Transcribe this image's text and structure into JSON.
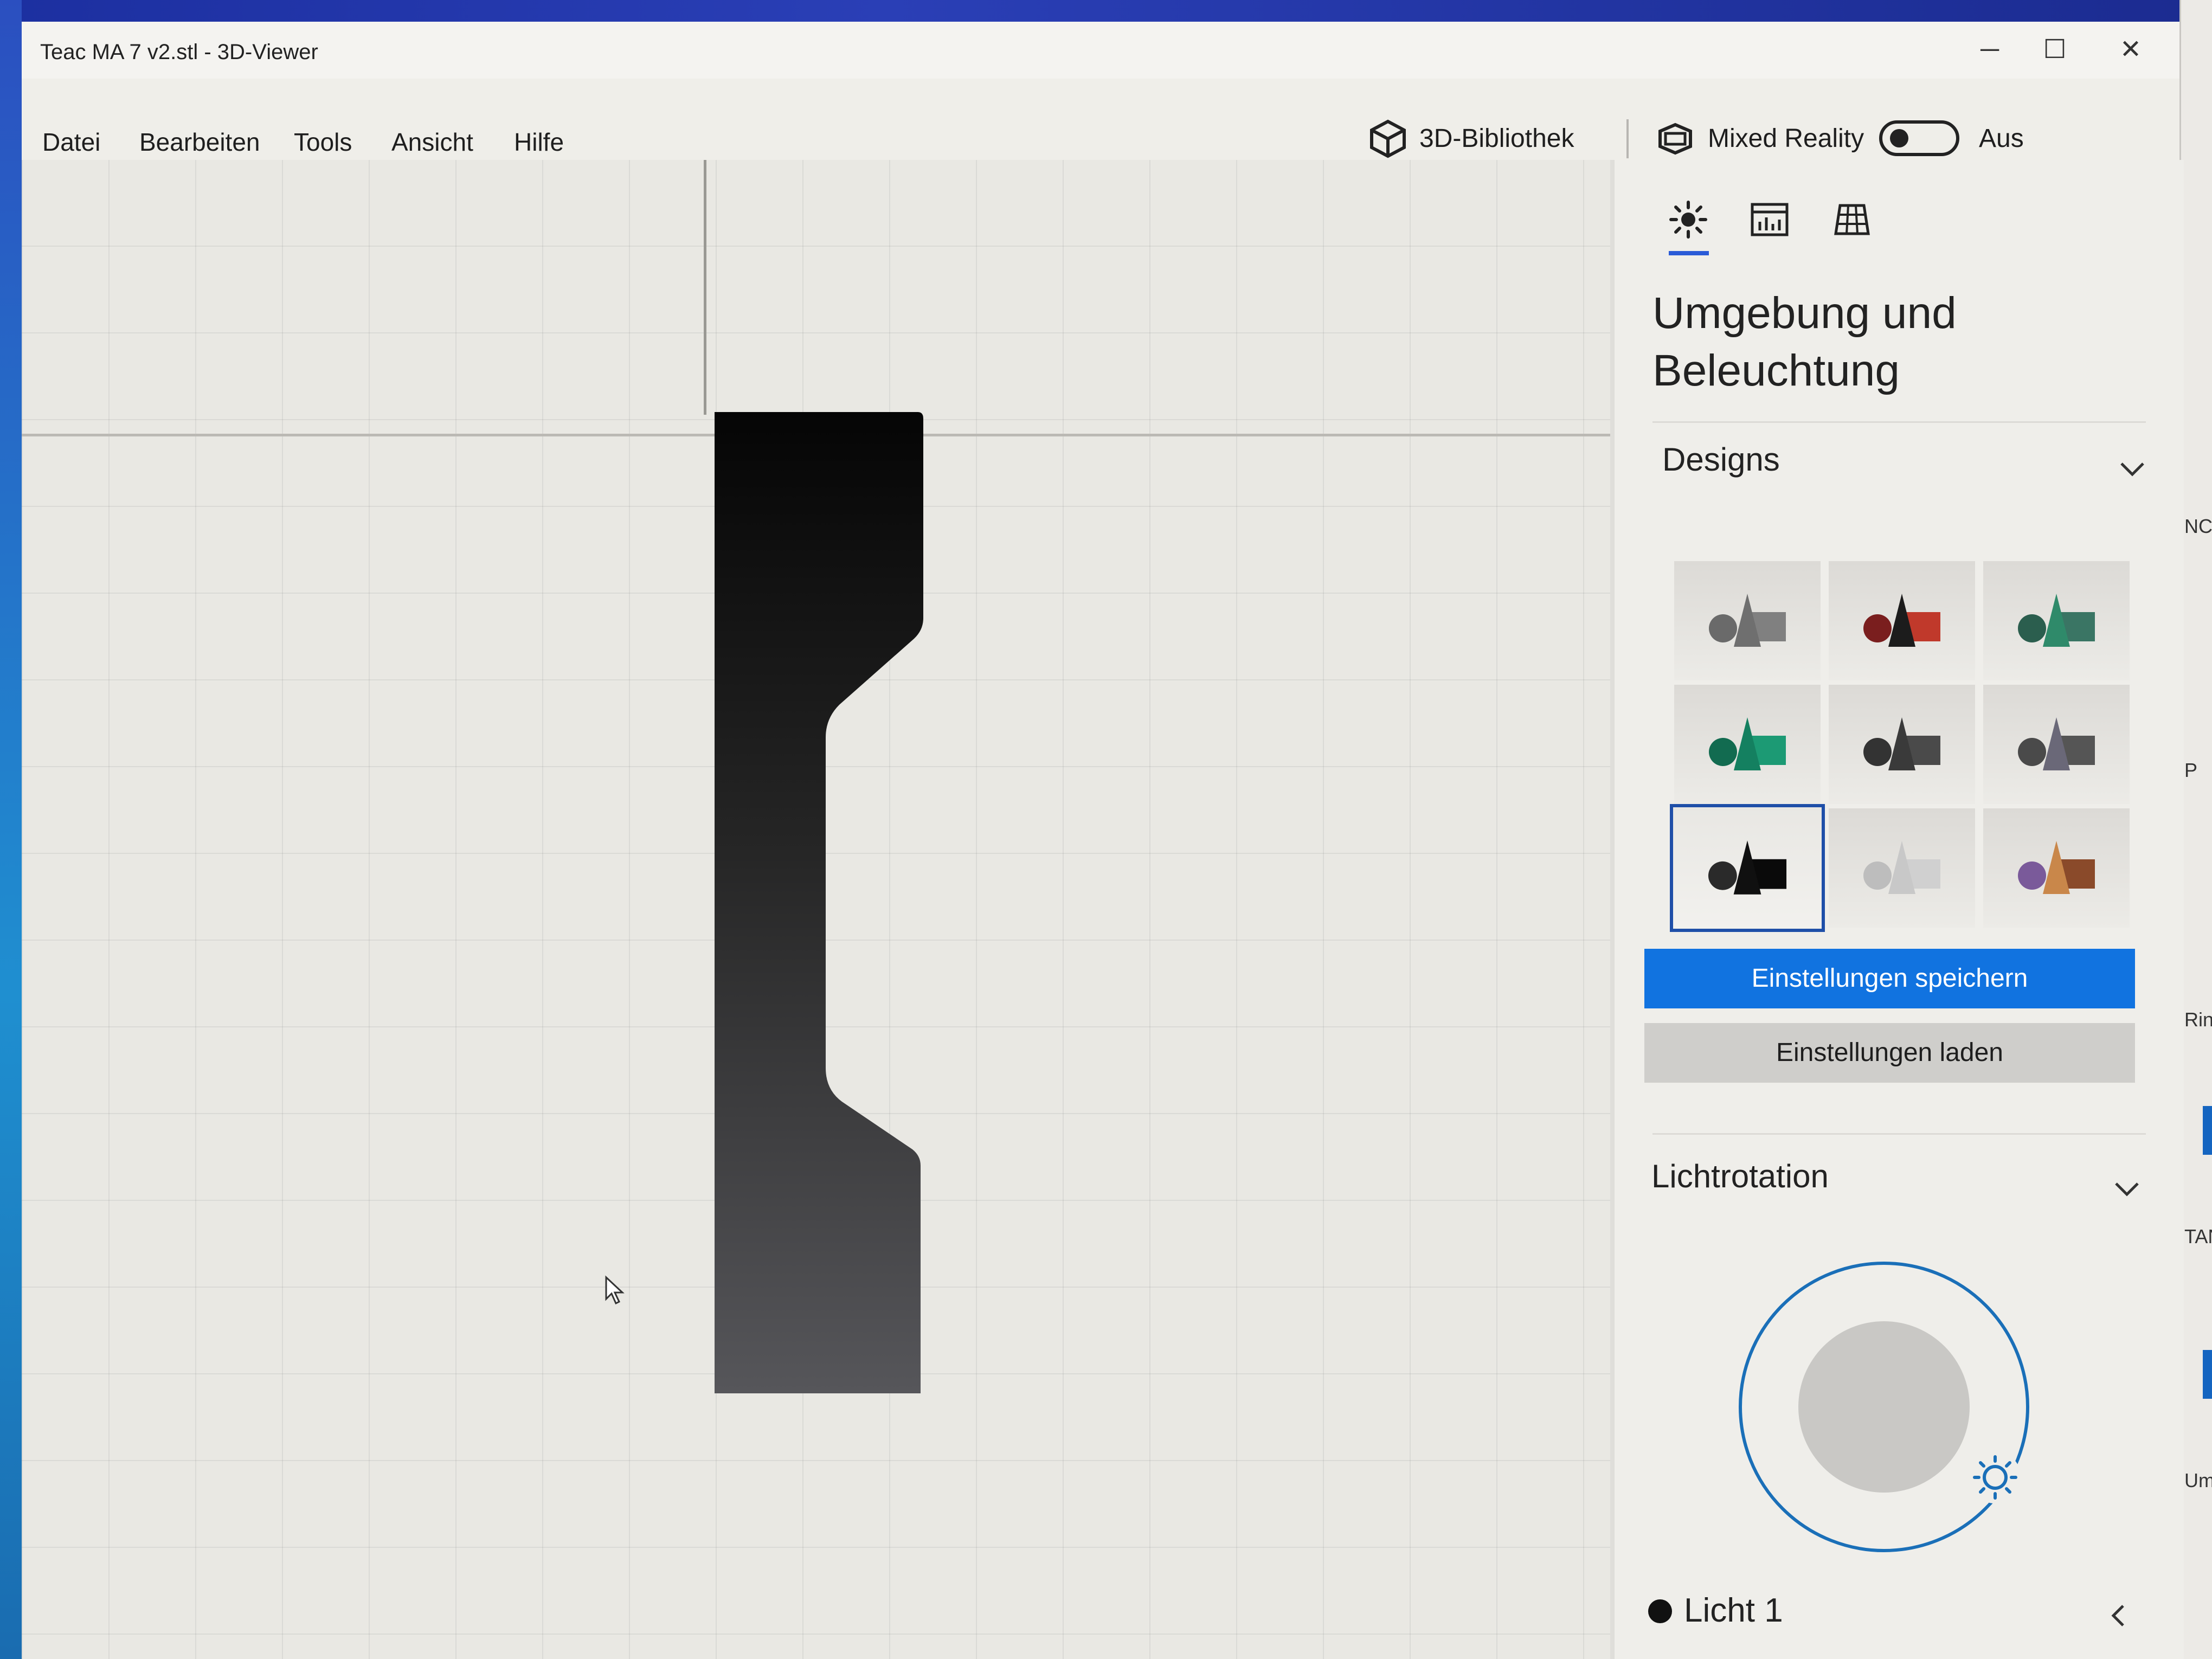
{
  "window": {
    "title": "Teac MA 7 v2.stl - 3D-Viewer",
    "controls": {
      "minimize": "─",
      "maximize": "☐",
      "close": "✕"
    }
  },
  "menu": {
    "items": [
      "Datei",
      "Bearbeiten",
      "Tools",
      "Ansicht",
      "Hilfe"
    ],
    "library_label": "3D-Bibliothek",
    "mixed_reality_label": "Mixed Reality",
    "mixed_reality_state": "Aus"
  },
  "panel": {
    "tabs": [
      "environment-lighting-tab",
      "stats-tab",
      "grid-tab"
    ],
    "heading": "Umgebung und Beleuchtung",
    "designs_label": "Designs",
    "designs": [
      {
        "cone": "#6f6f6f",
        "cube": "#808080",
        "sphere": "#6a6a6a",
        "selected": false
      },
      {
        "cone": "#1c1c1c",
        "cube": "#c0392b",
        "sphere": "#7a1e1e",
        "selected": false
      },
      {
        "cone": "#2f8a6a",
        "cube": "#3a7564",
        "sphere": "#2b5e4e",
        "selected": false
      },
      {
        "cone": "#148060",
        "cube": "#1c9a74",
        "sphere": "#126b50",
        "selected": false
      },
      {
        "cone": "#3a3a3a",
        "cube": "#4a4a4a",
        "sphere": "#333333",
        "selected": false
      },
      {
        "cone": "#6a6878",
        "cube": "#555555",
        "sphere": "#4a4a4a",
        "selected": false
      },
      {
        "cone": "#101010",
        "cube": "#0a0a0a",
        "sphere": "#2a2a2a",
        "selected": true
      },
      {
        "cone": "#c8c8c8",
        "cube": "#d0d0d0",
        "sphere": "#bdbdbd",
        "selected": false
      },
      {
        "cone": "#c9874a",
        "cube": "#8a4a2a",
        "sphere": "#7a5a9a",
        "selected": false
      }
    ],
    "save_button": "Einstellungen speichern",
    "load_button": "Einstellungen laden",
    "light_rotation_label": "Lichtrotation",
    "light_label": "Licht 1"
  },
  "desktop_fragments": [
    "NC",
    "P",
    "Rin",
    "TANI",
    "Um"
  ],
  "colors": {
    "accent": "#1173e0",
    "selected_border": "#1f4fa8",
    "dial": "#1a6fb8"
  }
}
